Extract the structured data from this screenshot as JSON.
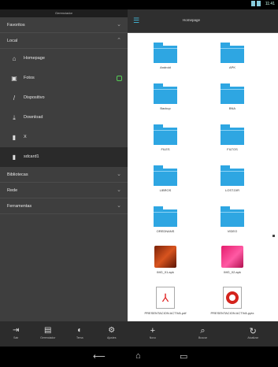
{
  "status_bar": {
    "time": "11:41"
  },
  "drawer": {
    "header": "Gerenciador",
    "sections_top": [
      {
        "label": "Favoritos",
        "chevron": "⌄"
      },
      {
        "label": "Local",
        "chevron": "⌃"
      }
    ],
    "items": [
      {
        "label": "Homepage",
        "icon": "home-icon",
        "glyph": "⌂"
      },
      {
        "label": "Fotos",
        "icon": "photos-icon",
        "glyph": "▣"
      },
      {
        "label": "Dispositivo",
        "icon": "device-icon",
        "glyph": "/"
      },
      {
        "label": "Download",
        "icon": "download-icon",
        "glyph": "⤓"
      },
      {
        "label": "X",
        "icon": "sd-card-icon",
        "glyph": "▮"
      },
      {
        "label": "sdcard1",
        "icon": "sd-card-icon",
        "glyph": "▮"
      }
    ],
    "sections_bottom": [
      {
        "label": "Bibliotecas",
        "chevron": "⌄"
      },
      {
        "label": "Rede",
        "chevron": "⌄"
      },
      {
        "label": "Ferramentas",
        "chevron": "⌄"
      }
    ],
    "bottom_buttons": [
      {
        "label": "Sair",
        "icon": "exit-icon",
        "glyph": "⇥"
      },
      {
        "label": "Gerenciador",
        "icon": "manager-icon",
        "glyph": "▤"
      },
      {
        "label": "Tema",
        "icon": "theme-icon",
        "glyph": "◐"
      },
      {
        "label": "Ajustes",
        "icon": "settings-icon",
        "glyph": "⚙"
      }
    ]
  },
  "content": {
    "title": "Homepage",
    "files": [
      {
        "name": "Android",
        "type": "folder"
      },
      {
        "name": "APK",
        "type": "folder"
      },
      {
        "name": "Backup",
        "type": "folder"
      },
      {
        "name": "BNA",
        "type": "folder"
      },
      {
        "name": "FILES",
        "type": "folder"
      },
      {
        "name": "FILTOS",
        "type": "folder"
      },
      {
        "name": "LIBROS",
        "type": "folder"
      },
      {
        "name": "LOST.DIR",
        "type": "folder"
      },
      {
        "name": "OREDNANS",
        "type": "folder"
      },
      {
        "name": "VIDEO",
        "type": "folder"
      },
      {
        "name": "IMG_01.apk",
        "type": "image-red"
      },
      {
        "name": "IMG_02.apk",
        "type": "image-pink"
      },
      {
        "name": "PRESENTACION ACTIVA.pdf",
        "type": "pdf"
      },
      {
        "name": "PRESENTACION ACTIVA.pptx",
        "type": "ppt"
      }
    ],
    "bottom_buttons": [
      {
        "label": "Novo",
        "icon": "add-icon",
        "glyph": "+"
      },
      {
        "label": "Buscar",
        "icon": "search-icon",
        "glyph": "⌕"
      },
      {
        "label": "Atualizar",
        "icon": "refresh-icon",
        "glyph": "↻"
      }
    ]
  },
  "nav": {
    "back": "⟵",
    "home": "⌂",
    "recent": "▭"
  }
}
